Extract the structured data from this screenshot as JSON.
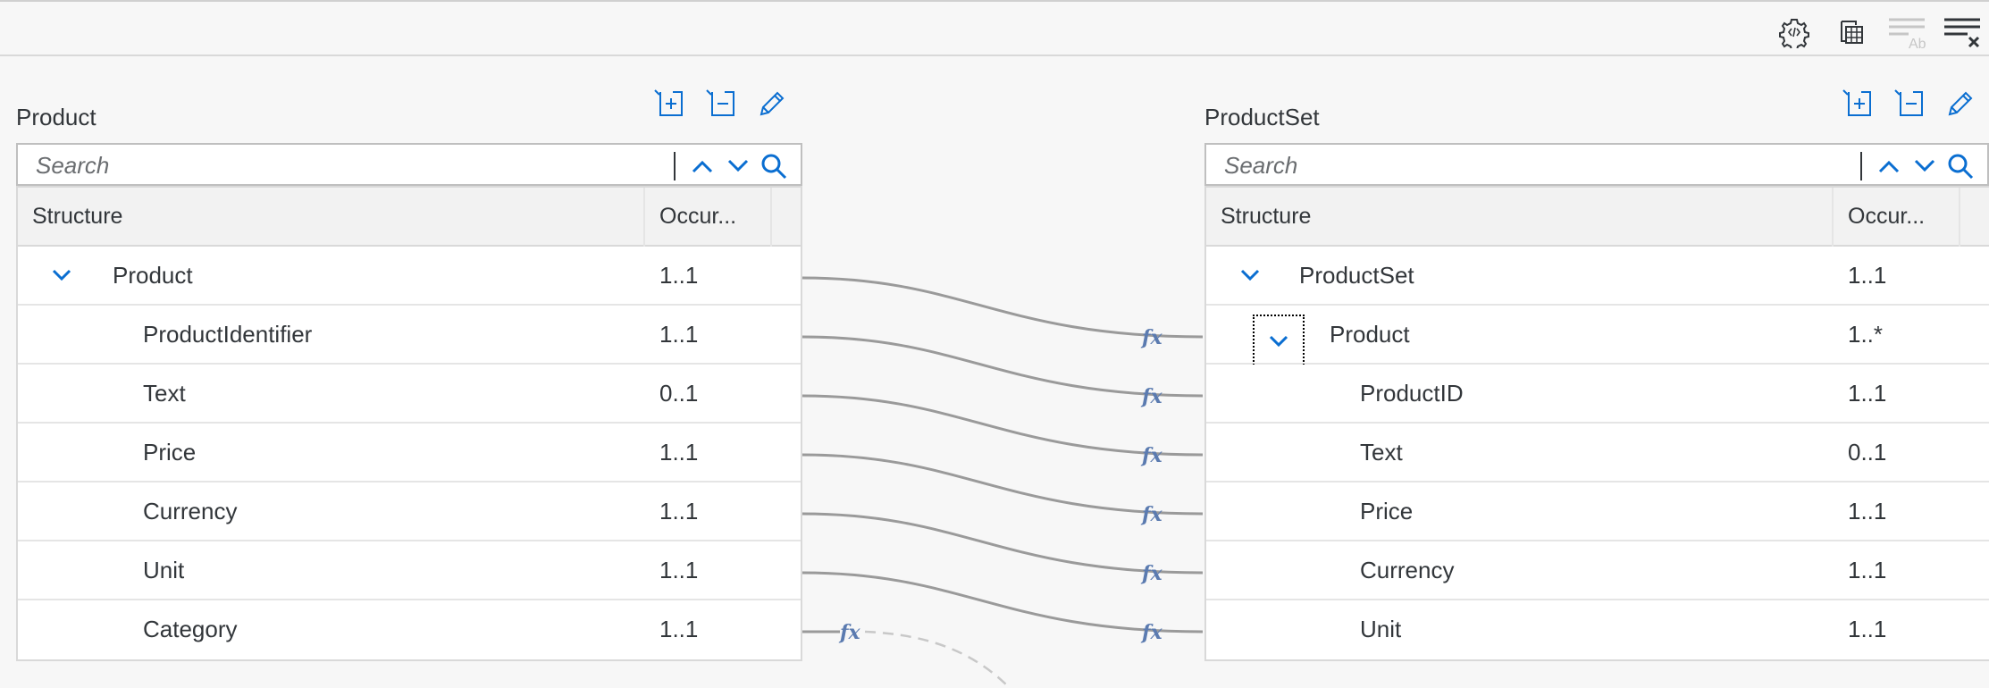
{
  "source": {
    "title": "Product",
    "search_placeholder": "Search",
    "headers": {
      "structure": "Structure",
      "occurrence": "Occur..."
    },
    "rows": [
      {
        "name": "Product",
        "occ": "1..1"
      },
      {
        "name": "ProductIdentifier",
        "occ": "1..1"
      },
      {
        "name": "Text",
        "occ": "0..1"
      },
      {
        "name": "Price",
        "occ": "1..1"
      },
      {
        "name": "Currency",
        "occ": "1..1"
      },
      {
        "name": "Unit",
        "occ": "1..1"
      },
      {
        "name": "Category",
        "occ": "1..1"
      }
    ]
  },
  "target": {
    "title": "ProductSet",
    "search_placeholder": "Search",
    "headers": {
      "structure": "Structure",
      "occurrence": "Occur..."
    },
    "rows": [
      {
        "name": "ProductSet",
        "occ": "1..1"
      },
      {
        "name": "Product",
        "occ": "1..*"
      },
      {
        "name": "ProductID",
        "occ": "1..1"
      },
      {
        "name": "Text",
        "occ": "0..1"
      },
      {
        "name": "Price",
        "occ": "1..1"
      },
      {
        "name": "Currency",
        "occ": "1..1"
      },
      {
        "name": "Unit",
        "occ": "1..1"
      }
    ]
  },
  "mapping_function_label": "fx",
  "colors": {
    "accent": "#0a6ed1",
    "line": "#9a9a9a",
    "fx": "#5b7bb0"
  }
}
